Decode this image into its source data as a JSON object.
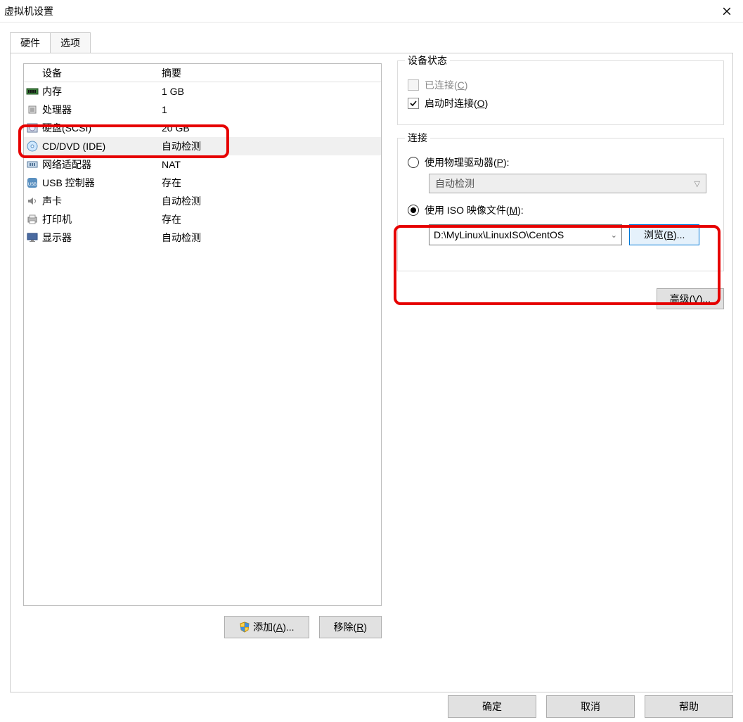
{
  "window": {
    "title": "虚拟机设置"
  },
  "tabs": {
    "hardware": "硬件",
    "options": "选项"
  },
  "device_table": {
    "header_device": "设备",
    "header_summary": "摘要",
    "rows": [
      {
        "icon": "memory",
        "name": "内存",
        "summary": "1 GB"
      },
      {
        "icon": "cpu",
        "name": "处理器",
        "summary": "1"
      },
      {
        "icon": "disk",
        "name": "硬盘(SCSI)",
        "summary": "20 GB"
      },
      {
        "icon": "cd",
        "name": "CD/DVD (IDE)",
        "summary": "自动检测"
      },
      {
        "icon": "net",
        "name": "网络适配器",
        "summary": "NAT"
      },
      {
        "icon": "usb",
        "name": "USB 控制器",
        "summary": "存在"
      },
      {
        "icon": "sound",
        "name": "声卡",
        "summary": "自动检测"
      },
      {
        "icon": "printer",
        "name": "打印机",
        "summary": "存在"
      },
      {
        "icon": "display",
        "name": "显示器",
        "summary": "自动检测"
      }
    ],
    "selected_index": 3
  },
  "device_state": {
    "legend": "设备状态",
    "connected_label": "已连接(",
    "connected_key": "C",
    "connected_suffix": ")",
    "connect_on_poweron_label": "启动时连接(",
    "connect_on_poweron_key": "O",
    "connect_on_poweron_suffix": ")"
  },
  "connection": {
    "legend": "连接",
    "physical_label": "使用物理驱动器(",
    "physical_key": "P",
    "physical_suffix": "):",
    "physical_combo": "自动检测",
    "iso_label": "使用 ISO 映像文件(",
    "iso_key": "M",
    "iso_suffix": "):",
    "iso_path": "D:\\MyLinux\\LinuxISO\\CentOS",
    "browse_label": "浏览(",
    "browse_key": "B",
    "browse_suffix": ")..."
  },
  "advanced": {
    "label": "高级(",
    "key": "V",
    "suffix": ")..."
  },
  "actions": {
    "add_label": "添加(",
    "add_key": "A",
    "add_suffix": ")...",
    "remove_label": "移除(",
    "remove_key": "R",
    "remove_suffix": ")"
  },
  "dialog": {
    "ok": "确定",
    "cancel": "取消",
    "help": "帮助"
  }
}
